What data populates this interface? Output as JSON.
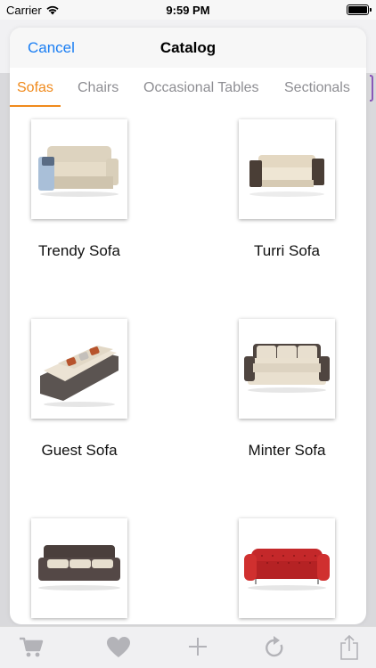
{
  "status_bar": {
    "carrier": "Carrier",
    "time": "9:59 PM"
  },
  "modal": {
    "cancel_label": "Cancel",
    "title": "Catalog"
  },
  "tabs": [
    {
      "label": "Sofas",
      "active": true
    },
    {
      "label": "Chairs",
      "active": false
    },
    {
      "label": "Occasional Tables",
      "active": false
    },
    {
      "label": "Sectionals",
      "active": false
    }
  ],
  "products": [
    {
      "name": "Trendy Sofa",
      "image": "sofa-beige-blue-cushions"
    },
    {
      "name": "Turri Sofa",
      "image": "sofa-cream-dark-arms"
    },
    {
      "name": "Guest Sofa",
      "image": "sofa-gray-base-pillows"
    },
    {
      "name": "Minter Sofa",
      "image": "sofa-cream-dark-frame"
    },
    {
      "name": "",
      "image": "sofa-dark-fabric-cream-cushions"
    },
    {
      "name": "",
      "image": "chesterfield-red-leather"
    }
  ],
  "tabbar": {
    "icons": [
      "cart-icon",
      "heart-icon",
      "plus-icon",
      "refresh-icon",
      "share-icon"
    ]
  },
  "colors": {
    "accent_tab": "#f08a1c",
    "cancel_blue": "#1a7ef3",
    "inactive_tab": "#8e8e93",
    "tabbar_icon": "#b3b3b8"
  }
}
